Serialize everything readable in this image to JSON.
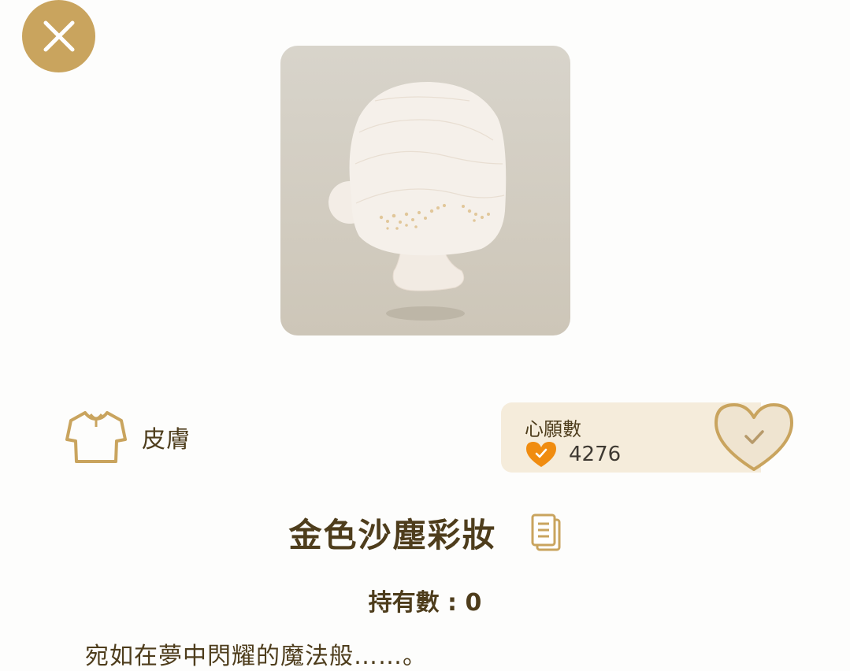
{
  "close_button": {
    "icon": "close-icon",
    "color": "#c9a45e"
  },
  "preview": {
    "icon": "skin-mannequin-icon"
  },
  "category": {
    "icon": "shirt-icon",
    "label": "皮膚"
  },
  "wishlist": {
    "label": "心願數",
    "count": "4276",
    "count_icon": "heart-check-icon",
    "button_icon": "heart-check-outline-icon",
    "accent_color": "#f08c10"
  },
  "item": {
    "title": "金色沙塵彩妝",
    "copy_icon": "copy-icon",
    "owned": "持有數 : 0",
    "description": "宛如在夢中閃耀的魔法般……。"
  }
}
